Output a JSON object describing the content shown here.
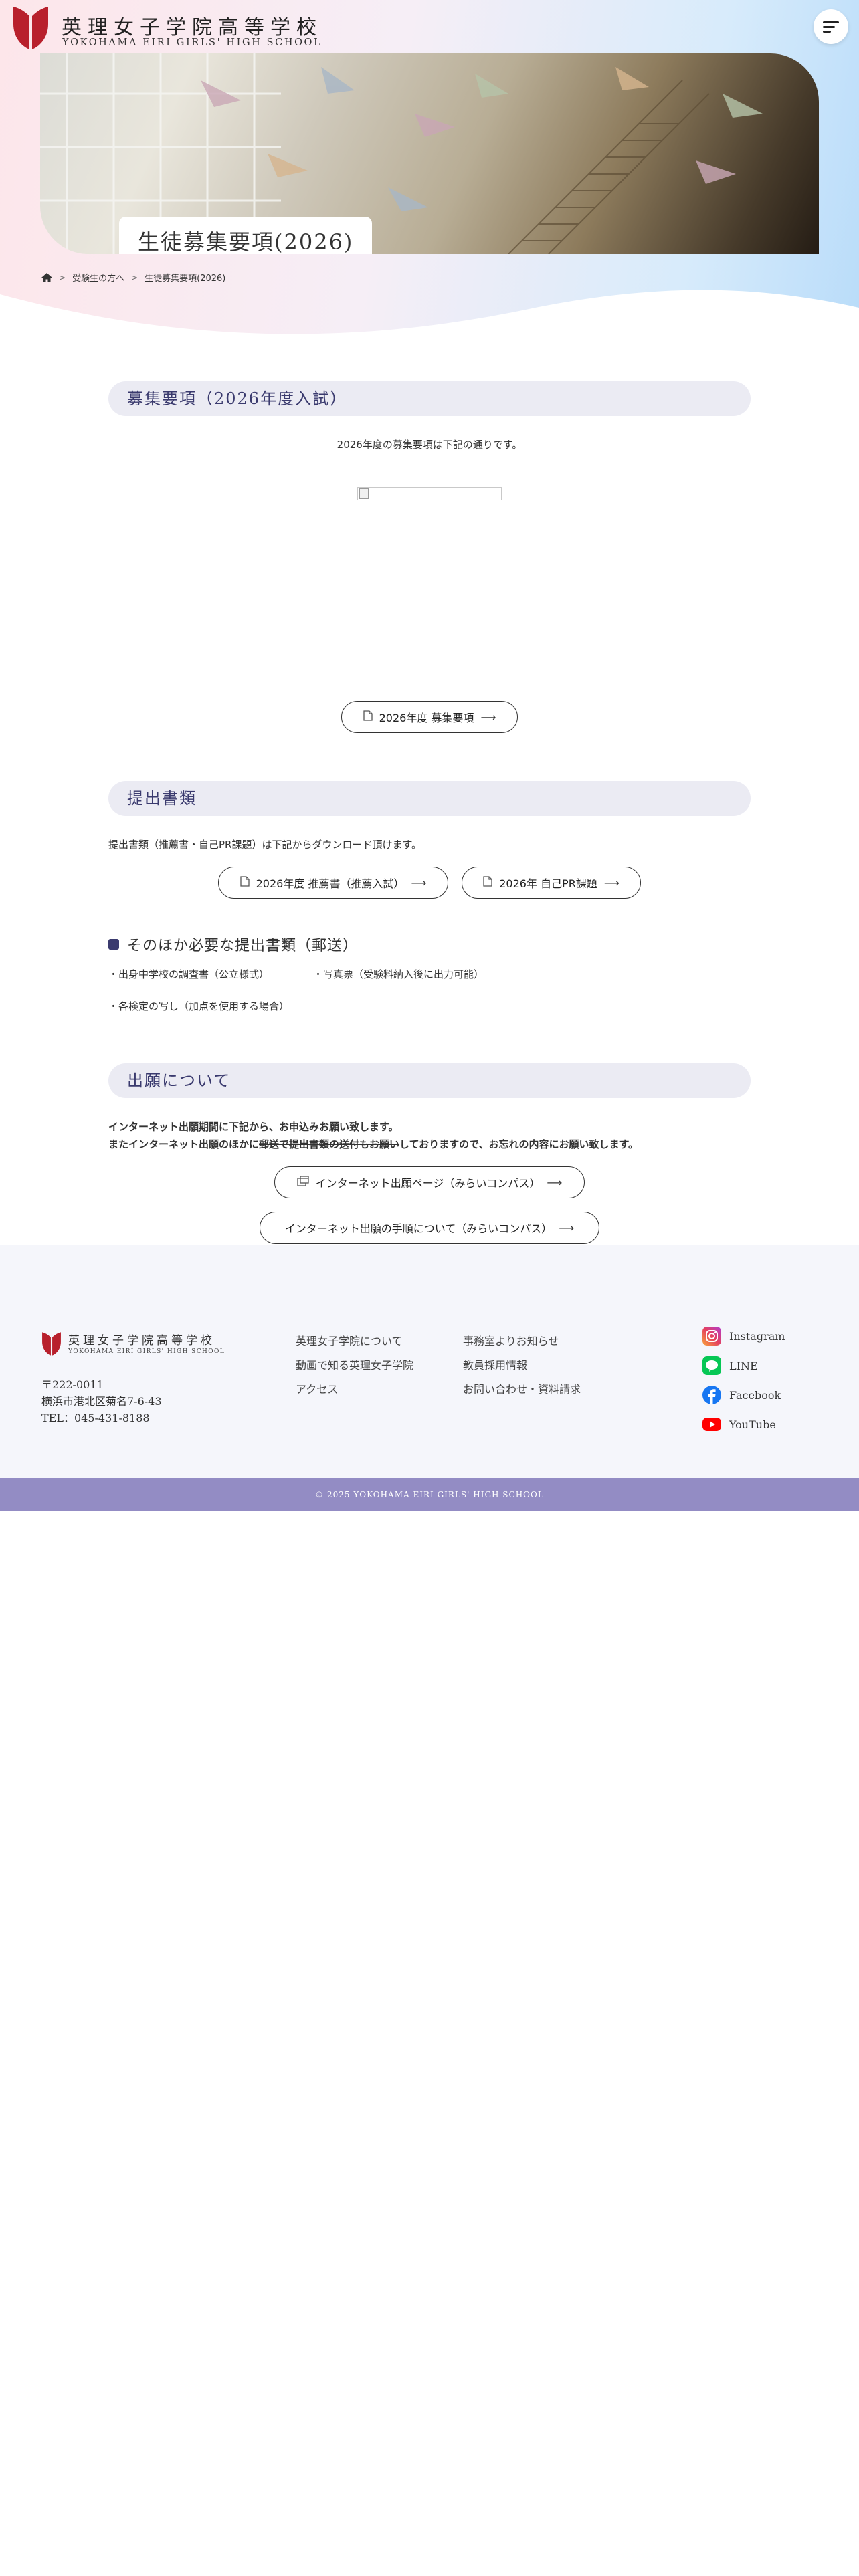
{
  "header": {
    "logo_jp": "英理女子学院高等学校",
    "logo_en": "YOKOHAMA EIRI GIRLS' HIGH SCHOOL",
    "menu_icon": "hamburger-menu-icon"
  },
  "hero": {
    "title": "生徒募集要項(2026)"
  },
  "breadcrumb": {
    "home_icon": "home-icon",
    "items": [
      "受験生の方へ",
      "生徒募集要項(2026)"
    ]
  },
  "recruitment": {
    "heading": "募集要項（2026年度入試）",
    "intro": "2026年度の募集要項は下記の通りです。",
    "button_label": "2026年度 募集要項"
  },
  "documents": {
    "heading": "提出書類",
    "intro": "提出書類（推薦書・自己PR課題）は下記からダウンロード頂けます。",
    "buttons": [
      "2026年度 推薦書（推薦入試）",
      "2026年 自己PR課題"
    ],
    "sub_heading": "そのほか必要な提出書類（郵送）",
    "list": [
      "・出身中学校の調査書（公立様式）",
      "・写真票（受験料納入後に出力可能）",
      "・各検定の写し（加点を使用する場合）"
    ]
  },
  "application": {
    "heading": "出願について",
    "line1": "インターネット出願期間に下記から、お申込みお願い致します。",
    "line2_prefix": "またインターネット出願のほかに",
    "line2_struck": "郵送で提出書類の送付もお願い",
    "line2_suffix": "しておりますので、お忘れの内容にお願い致します。",
    "buttons": [
      "インターネット出願ページ（みらいコンパス）",
      "インターネット出願の手順について（みらいコンパス）"
    ]
  },
  "footer": {
    "logo_jp": "英理女子学院高等学校",
    "logo_en": "YOKOHAMA EIRI GIRLS' HIGH SCHOOL",
    "postal": "〒222-0011",
    "address": "横浜市港北区菊名7-6-43",
    "tel": "TEL：045-431-8188",
    "links_col1": [
      "英理女子学院について",
      "動画で知る英理女子学院",
      "アクセス"
    ],
    "links_col2": [
      "事務室よりお知らせ",
      "教員採用情報",
      "お問い合わせ・資料請求"
    ],
    "sns": [
      "Instagram",
      "LINE",
      "Facebook",
      "YouTube"
    ],
    "copyright": "© 2025 YOKOHAMA EIRI GIRLS' HIGH SCHOOL"
  },
  "colors": {
    "brand_red": "#b8202c",
    "heading_navy": "#3a3a6e",
    "footer_bar": "#938cc4"
  }
}
